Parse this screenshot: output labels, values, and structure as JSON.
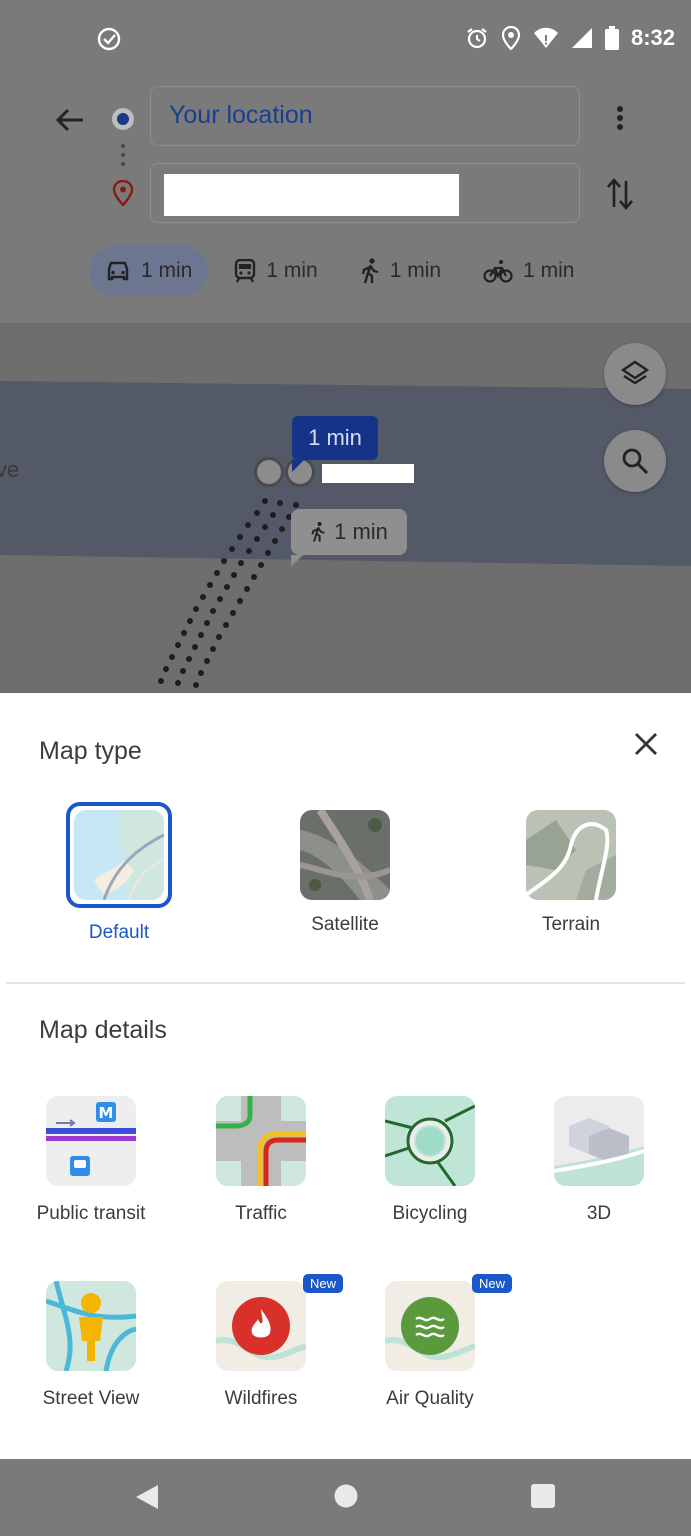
{
  "status_bar": {
    "time": "8:32",
    "icons": [
      "task-done-icon",
      "alarm-icon",
      "location-icon",
      "wifi-icon",
      "signal-icon",
      "battery-icon"
    ]
  },
  "directions": {
    "origin_text": "Your location",
    "modes": [
      {
        "icon": "car-icon",
        "label": "1 min",
        "selected": true
      },
      {
        "icon": "transit-icon",
        "label": "1 min",
        "selected": false
      },
      {
        "icon": "walk-icon",
        "label": "1 min",
        "selected": false
      },
      {
        "icon": "bike-icon",
        "label": "1 min",
        "selected": false
      }
    ]
  },
  "map": {
    "drive_eta": "1 min",
    "walk_eta": "1 min",
    "edge_label": "ve"
  },
  "sheet": {
    "map_type_title": "Map type",
    "map_types": [
      {
        "label": "Default",
        "selected": true
      },
      {
        "label": "Satellite",
        "selected": false
      },
      {
        "label": "Terrain",
        "selected": false
      }
    ],
    "map_details_title": "Map details",
    "details": [
      {
        "label": "Public transit"
      },
      {
        "label": "Traffic"
      },
      {
        "label": "Bicycling"
      },
      {
        "label": "3D"
      },
      {
        "label": "Street View"
      },
      {
        "label": "Wildfires",
        "badge": "New"
      },
      {
        "label": "Air Quality",
        "badge": "New"
      }
    ]
  },
  "colors": {
    "accent": "#1a57c8",
    "overlay": "#7a7a7a",
    "drive_badge": "#16338a"
  }
}
